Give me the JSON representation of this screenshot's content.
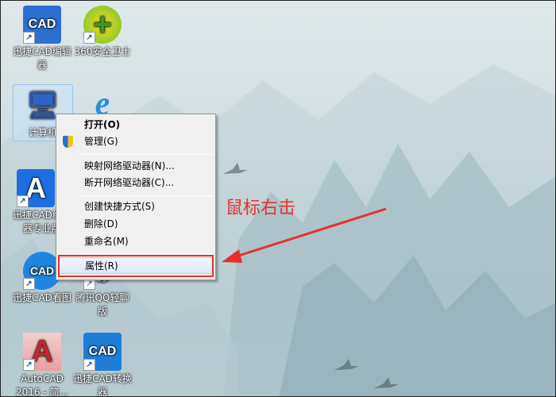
{
  "desktop_icons": [
    {
      "label": "迅捷CAD编辑器",
      "glyph": "CAD",
      "color": "#2d6fd1"
    },
    {
      "label": "360安全卫士",
      "glyph": "+",
      "color": "#6bbf2a"
    },
    {
      "label": "计算机",
      "glyph": "🖥",
      "color": "#2f63c8"
    },
    {
      "label": "",
      "glyph": "e",
      "color": "#2a8fd8"
    },
    {
      "label": "迅捷CAD编辑器专业版",
      "glyph": "A",
      "color": "#1d6fe0"
    },
    {
      "label": "迅捷CAD看图",
      "glyph": "CAD",
      "color": "#1f86e0"
    },
    {
      "label": "腾讯QQ轻聊版",
      "glyph": "🐧",
      "color": "#eee"
    },
    {
      "label": "AutoCAD 2016 - 简...",
      "glyph": "A",
      "color": "#c2272d"
    },
    {
      "label": "迅捷CAD转换器",
      "glyph": "CAD",
      "color": "#1f7fd8"
    }
  ],
  "context_menu": {
    "items": [
      "打开(O)",
      "管理(G)",
      "映射网络驱动器(N)...",
      "断开网络驱动器(C)...",
      "创建快捷方式(S)",
      "删除(D)",
      "重命名(M)",
      "属性(R)"
    ]
  },
  "annotation": {
    "text": "鼠标右击",
    "color": "#e53030"
  }
}
